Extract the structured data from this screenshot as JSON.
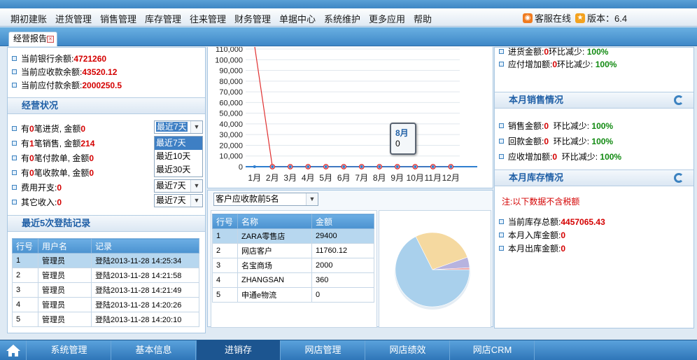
{
  "menu": {
    "items": [
      "期初建账",
      "进货管理",
      "销售管理",
      "库存管理",
      "往来管理",
      "财务管理",
      "单据中心",
      "系统维护",
      "更多应用",
      "帮助"
    ],
    "service": "客服在线",
    "version": "版本：6.4"
  },
  "tab": {
    "label": "经营报告"
  },
  "balance": {
    "bank_label": "当前银行余额:",
    "bank_value": "4721260",
    "receivable_label": "当前应收款余额:",
    "receivable_value": "43520.12",
    "payable_label": "当前应付款余额:",
    "payable_value": "2000250.5"
  },
  "status": {
    "title": "经营状况",
    "l1a": "有",
    "l1b": "0",
    "l1c": "笔进货, 金额",
    "l1d": "0",
    "l2a": "有",
    "l2b": "1",
    "l2c": "笔销售, 金额",
    "l2d": "214",
    "l3a": "有",
    "l3b": "0",
    "l3c": "笔付款单, 金额",
    "l3d": "0",
    "l4a": "有",
    "l4b": "0",
    "l4c": "笔收款单, 金额",
    "l4d": "0",
    "expense_label": "费用开支:",
    "expense_value": "0",
    "other_label": "其它收入:",
    "other_value": "0",
    "period_selected": "最近7天",
    "period_options": [
      "最近7天",
      "最近10天",
      "最近30天"
    ]
  },
  "logins": {
    "title": "最近5次登陆记录",
    "headers": [
      "行号",
      "用户名",
      "记录"
    ],
    "rows": [
      [
        "1",
        "管理员",
        "登陆2013-11-28 14:25:34"
      ],
      [
        "2",
        "管理员",
        "登陆2013-11-28 14:21:58"
      ],
      [
        "3",
        "管理员",
        "登陆2013-11-28 14:21:49"
      ],
      [
        "4",
        "管理员",
        "登陆2013-11-28 14:20:26"
      ],
      [
        "5",
        "管理员",
        "登陆2013-11-28 14:20:10"
      ]
    ]
  },
  "chart_data": [
    {
      "type": "line",
      "categories": [
        "1月",
        "2月",
        "3月",
        "4月",
        "5月",
        "6月",
        "7月",
        "8月",
        "9月",
        "10月",
        "11月",
        "12月"
      ],
      "series": [
        {
          "values": [
            112000,
            0,
            0,
            0,
            0,
            0,
            0,
            0,
            0,
            0,
            0,
            0
          ],
          "color": "#e03030"
        },
        {
          "values": [
            0,
            0,
            0,
            0,
            0,
            0,
            0,
            0,
            0,
            0,
            0,
            0
          ],
          "color": "#2f7fd0"
        }
      ],
      "yticks": [
        "0",
        "10,000",
        "20,000",
        "30,000",
        "40,000",
        "50,000",
        "60,000",
        "70,000",
        "80,000",
        "90,000",
        "100,000",
        "110,000"
      ],
      "ylim": [
        0,
        110000
      ],
      "grid": true,
      "tooltip": {
        "label": "8月",
        "value": "0"
      }
    },
    {
      "type": "pie",
      "categories": [
        "ZARA零售店",
        "网店客户",
        "名宝商场",
        "ZHANGSAN",
        "申通e物流"
      ],
      "values": [
        29400,
        11760.12,
        2000,
        360,
        0
      ],
      "colors": [
        "#a9d0ec",
        "#f5d9a0",
        "#b7b3df",
        "#f0a0a0",
        "#cfe3c4"
      ]
    }
  ],
  "customers": {
    "select_label": "客户应收款前5名",
    "headers": [
      "行号",
      "名称",
      "金额"
    ],
    "rows": [
      [
        "1",
        "ZARA零售店",
        "29400"
      ],
      [
        "2",
        "网店客户",
        "11760.12"
      ],
      [
        "3",
        "名宝商场",
        "2000"
      ],
      [
        "4",
        "ZHANGSAN",
        "360"
      ],
      [
        "5",
        "申通e物流",
        "0"
      ]
    ]
  },
  "purchase": {
    "top_a": "进货金额:",
    "top_b": "0",
    "top_c": "环比减少:",
    "top_d": "100%",
    "payable_a": "应付增加额:",
    "payable_b": "0",
    "payable_c": "环比减少:",
    "payable_d": "100%"
  },
  "sales": {
    "title": "本月销售情况",
    "r1a": "销售金额:",
    "r1b": "0",
    "r1c": "环比减少:",
    "r1d": "100%",
    "r2a": "回款金额:",
    "r2b": "0",
    "r2c": "环比减少:",
    "r2d": "100%",
    "r3a": "应收增加额:",
    "r3b": "0",
    "r3c": "环比减少:",
    "r3d": "100%"
  },
  "stock": {
    "title": "本月库存情况",
    "note": "注:以下数据不含税额",
    "r1a": "当前库存总额:",
    "r1b": "4457065.43",
    "r2a": "本月入库金额:",
    "r2b": "0",
    "r3a": "本月出库金额:",
    "r3b": "0"
  },
  "bottom": {
    "items": [
      "系统管理",
      "基本信息",
      "进销存",
      "网店管理",
      "网店绩效",
      "网店CRM"
    ],
    "active": "进销存"
  }
}
